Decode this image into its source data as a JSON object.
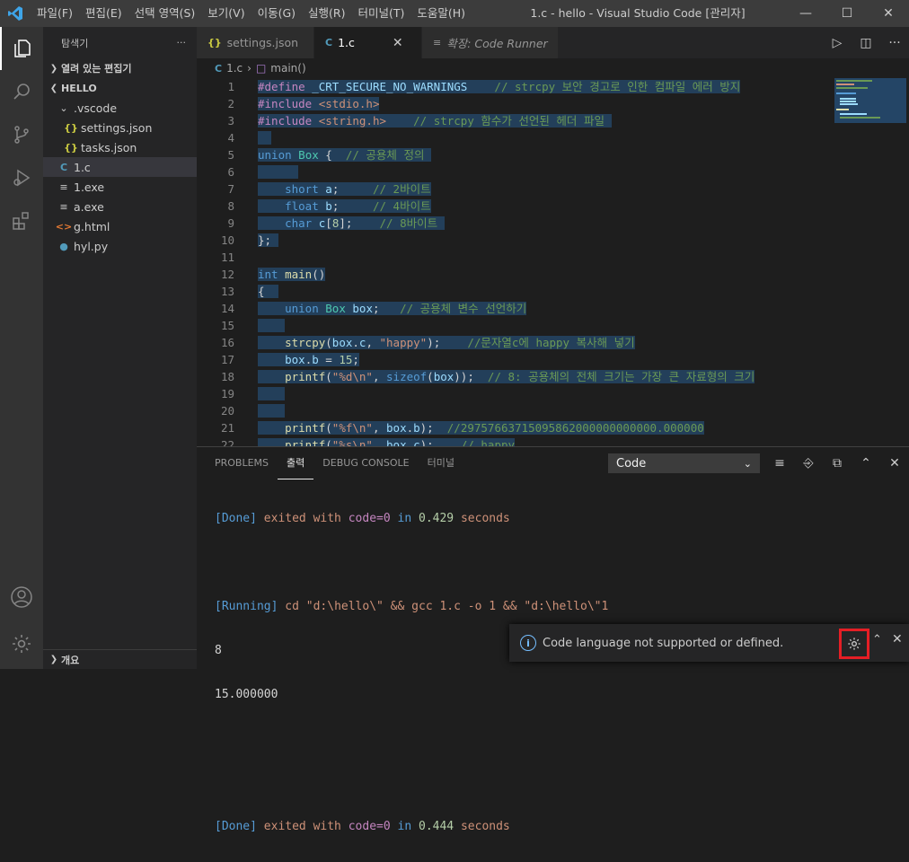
{
  "titlebar": {
    "menu": [
      "파일(F)",
      "편집(E)",
      "선택 영역(S)",
      "보기(V)",
      "이동(G)",
      "실행(R)",
      "터미널(T)",
      "도움말(H)"
    ],
    "title": "1.c - hello - Visual Studio Code [관리자]"
  },
  "sidebar": {
    "header": "탐색기",
    "open_editors": "열려 있는 편집기",
    "folder": "HELLO",
    "items": [
      {
        "label": ".vscode",
        "icon": "chevron-down-icon"
      },
      {
        "label": "settings.json",
        "icon": "json-icon"
      },
      {
        "label": "tasks.json",
        "icon": "json-icon"
      },
      {
        "label": "1.c",
        "icon": "c-file-icon"
      },
      {
        "label": "1.exe",
        "icon": "file-icon"
      },
      {
        "label": "a.exe",
        "icon": "file-icon"
      },
      {
        "label": "g.html",
        "icon": "html-icon"
      },
      {
        "label": "hyl.py",
        "icon": "python-icon"
      }
    ],
    "outline": "개요"
  },
  "tabs": [
    {
      "label": "settings.json",
      "icon": "json-icon"
    },
    {
      "label": "1.c",
      "icon": "c-file-icon"
    },
    {
      "label": "확장: Code Runner",
      "icon": "extension-icon"
    }
  ],
  "breadcrumb": {
    "file": "1.c",
    "symbol": "main()"
  },
  "editor": {
    "line_numbers": [
      "1",
      "2",
      "3",
      "4",
      "5",
      "6",
      "7",
      "8",
      "9",
      "10",
      "11",
      "12",
      "13",
      "14",
      "15",
      "16",
      "17",
      "18",
      "19",
      "20",
      "21",
      "22"
    ]
  },
  "panel": {
    "tabs": [
      "PROBLEMS",
      "출력",
      "DEBUG CONSOLE",
      "터미널"
    ],
    "channel": "Code",
    "output": {
      "done1_tag": "[Done]",
      "done1_text": " exited with ",
      "done1_code": "code=0",
      "done1_in": " in ",
      "done1_time": "0.429",
      "done1_sec": " seconds",
      "running_tag": "[Running]",
      "running_cmd": " cd \"d:\\hello\\\" && gcc 1.c -o 1 && \"d:\\hello\\\"1",
      "out1": "8",
      "out2": "15.000000",
      "done2_tag": "[Done]",
      "done2_text": " exited with ",
      "done2_code": "code=0",
      "done2_in": " in ",
      "done2_time": "0.444",
      "done2_sec": " seconds"
    }
  },
  "notification": {
    "message": "Code language not supported or defined."
  },
  "colors": {
    "accent": "#007acc",
    "highlight_box": "#e51e25",
    "selection": "#264f78"
  }
}
